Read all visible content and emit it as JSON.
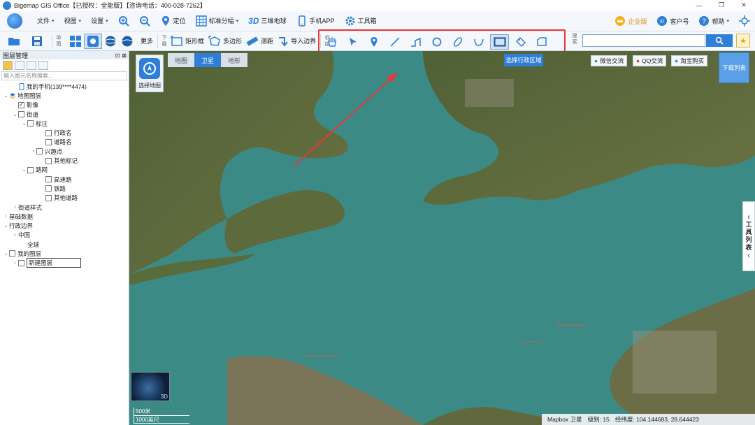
{
  "window": {
    "title": "Bigemap GIS Office【已授权：全能版】【咨询电话：400-028-7262】",
    "controls": [
      "—",
      "❐",
      "✕"
    ]
  },
  "menu": {
    "file": "文件",
    "view": "视图",
    "settings": "设置",
    "locate": "定位",
    "grid": "标准分幅",
    "earth3d_badge": "3D",
    "earth3d": "三维地球",
    "mobile_app": "手机APP",
    "toolbox": "工具箱",
    "enterprise": "企业版",
    "customer": "客户号",
    "help": "帮助"
  },
  "toolbar": {
    "single_label": "单图",
    "more": "更多",
    "download_label": "下载",
    "rect": "矩形框",
    "polygon": "多边形",
    "measure": "测距",
    "import_border": "导入边界",
    "draw_label": "标绘",
    "search_label": "搜索",
    "search_placeholder": ""
  },
  "draw_tools": [
    {
      "name": "pan-hand-icon"
    },
    {
      "name": "select-arrow-icon"
    },
    {
      "name": "point-marker-icon"
    },
    {
      "name": "line-icon"
    },
    {
      "name": "polyline-icon"
    },
    {
      "name": "circle-icon"
    },
    {
      "name": "ellipse-icon"
    },
    {
      "name": "curve-icon"
    },
    {
      "name": "rectangle-icon"
    },
    {
      "name": "tag-label-icon"
    },
    {
      "name": "polygon-shape-icon"
    }
  ],
  "panel": {
    "title": "图层管理",
    "search_placeholder": "输入图元名称搜索...",
    "tree": [
      {
        "label": "我的手机(139****4474)",
        "indent": 1,
        "arrow": "",
        "cb": "",
        "icon": "phone"
      },
      {
        "label": "地图图层",
        "indent": 0,
        "arrow": "⌄",
        "cb": "",
        "icon": "layers"
      },
      {
        "label": "影像",
        "indent": 1,
        "arrow": "",
        "cb": "✓",
        "icon": ""
      },
      {
        "label": "街道",
        "indent": 1,
        "arrow": "⌄",
        "cb": " ",
        "icon": ""
      },
      {
        "label": "标注",
        "indent": 2,
        "arrow": "⌄",
        "cb": " ",
        "icon": ""
      },
      {
        "label": "行政名",
        "indent": 4,
        "arrow": "",
        "cb": " ",
        "icon": ""
      },
      {
        "label": "道路名",
        "indent": 4,
        "arrow": "",
        "cb": " ",
        "icon": ""
      },
      {
        "label": "兴趣点",
        "indent": 3,
        "arrow": "›",
        "cb": " ",
        "icon": ""
      },
      {
        "label": "其他标记",
        "indent": 4,
        "arrow": "",
        "cb": " ",
        "icon": ""
      },
      {
        "label": "路网",
        "indent": 2,
        "arrow": "⌄",
        "cb": " ",
        "icon": ""
      },
      {
        "label": "高速路",
        "indent": 4,
        "arrow": "",
        "cb": " ",
        "icon": ""
      },
      {
        "label": "铁路",
        "indent": 4,
        "arrow": "",
        "cb": " ",
        "icon": ""
      },
      {
        "label": "其他道路",
        "indent": 4,
        "arrow": "",
        "cb": " ",
        "icon": ""
      },
      {
        "label": "街道样式",
        "indent": 1,
        "arrow": "›",
        "cb": "",
        "icon": ""
      },
      {
        "label": "基础数据",
        "indent": 0,
        "arrow": "›",
        "cb": "",
        "icon": ""
      },
      {
        "label": "行政边界",
        "indent": 0,
        "arrow": "⌄",
        "cb": "",
        "icon": ""
      },
      {
        "label": "中国",
        "indent": 1,
        "arrow": "›",
        "cb": "",
        "icon": ""
      },
      {
        "label": "全球",
        "indent": 2,
        "arrow": "",
        "cb": "",
        "icon": ""
      },
      {
        "label": "我的图层",
        "indent": 0,
        "arrow": "⌄",
        "cb": " ",
        "icon": ""
      },
      {
        "label": "新建图层",
        "indent": 1,
        "arrow": "›",
        "cb": " ",
        "icon": "",
        "boxed": true
      }
    ]
  },
  "map": {
    "tabs": [
      "地图",
      "卫星",
      "地形"
    ],
    "active_tab": 1,
    "choose_map": "选择地图",
    "select_region": "选择行政区域",
    "wechat": "微信交流",
    "qq": "QQ交流",
    "taobao": "淘宝购买",
    "download_list": "下载列表",
    "tool_list": [
      "工",
      "具",
      "列",
      "表"
    ],
    "minimap_badge": "3D",
    "scale_metric": "500米",
    "scale_imperial": "1000英尺",
    "source": "Mapbox 卫星",
    "level_label": "级别:",
    "level": "15",
    "coord_label": "经纬度:",
    "coords": "104.144683, 28.644423"
  },
  "colors": {
    "accent": "#2f7fd8",
    "highlight": "#e33a3a",
    "water": "#3b8a86",
    "land": "#5a6b3c"
  }
}
